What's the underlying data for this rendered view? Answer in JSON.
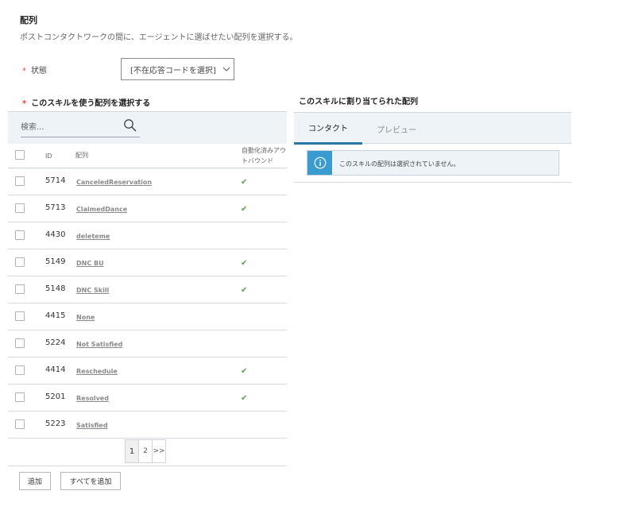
{
  "section": {
    "title": "配列",
    "description": "ポストコンタクトワークの間に、エージェントに選ばせたい配列を選択する。"
  },
  "state_field": {
    "required_mark": "*",
    "label": "状態",
    "selected_value": "[不在応答コードを選択]"
  },
  "left_panel": {
    "required_mark": "*",
    "heading": "このスキルを使う配列を選択する",
    "search": {
      "placeholder": "検索..."
    },
    "columns": {
      "id": "ID",
      "disposition": "配列",
      "auto_outbound": "自動化済みアウトバウンド"
    },
    "rows": [
      {
        "id": "5714",
        "name": "CanceledReservation",
        "auto": "✔"
      },
      {
        "id": "5713",
        "name": "ClaimedDance",
        "auto": "✔"
      },
      {
        "id": "4430",
        "name": "deleteme",
        "auto": ""
      },
      {
        "id": "5149",
        "name": "DNC BU",
        "auto": "✔"
      },
      {
        "id": "5148",
        "name": "DNC Skill",
        "auto": "✔"
      },
      {
        "id": "4415",
        "name": "None",
        "auto": ""
      },
      {
        "id": "5224",
        "name": "Not Satisfied",
        "auto": ""
      },
      {
        "id": "4414",
        "name": "Reschedule",
        "auto": "✔"
      },
      {
        "id": "5201",
        "name": "Resolved",
        "auto": "✔"
      },
      {
        "id": "5223",
        "name": "Satisfied",
        "auto": ""
      }
    ],
    "pagination": {
      "pages": [
        "1",
        "2"
      ],
      "current": "1",
      "next": ">>"
    },
    "buttons": {
      "add": "追加",
      "add_all": "すべてを追加"
    }
  },
  "right_panel": {
    "heading": "このスキルに割り当てられた配列",
    "tabs": {
      "contact": "コンタクト",
      "preview": "プレビュー"
    },
    "info_message": "このスキルの配列は選択されていません。"
  },
  "colors": {
    "accent": "#2877a6",
    "info": "#3a9bd1",
    "required": "#e5423c",
    "check": "#5aa04a"
  },
  "icons": [
    "search-icon",
    "chevron-down-icon",
    "info-icon",
    "check-icon"
  ]
}
